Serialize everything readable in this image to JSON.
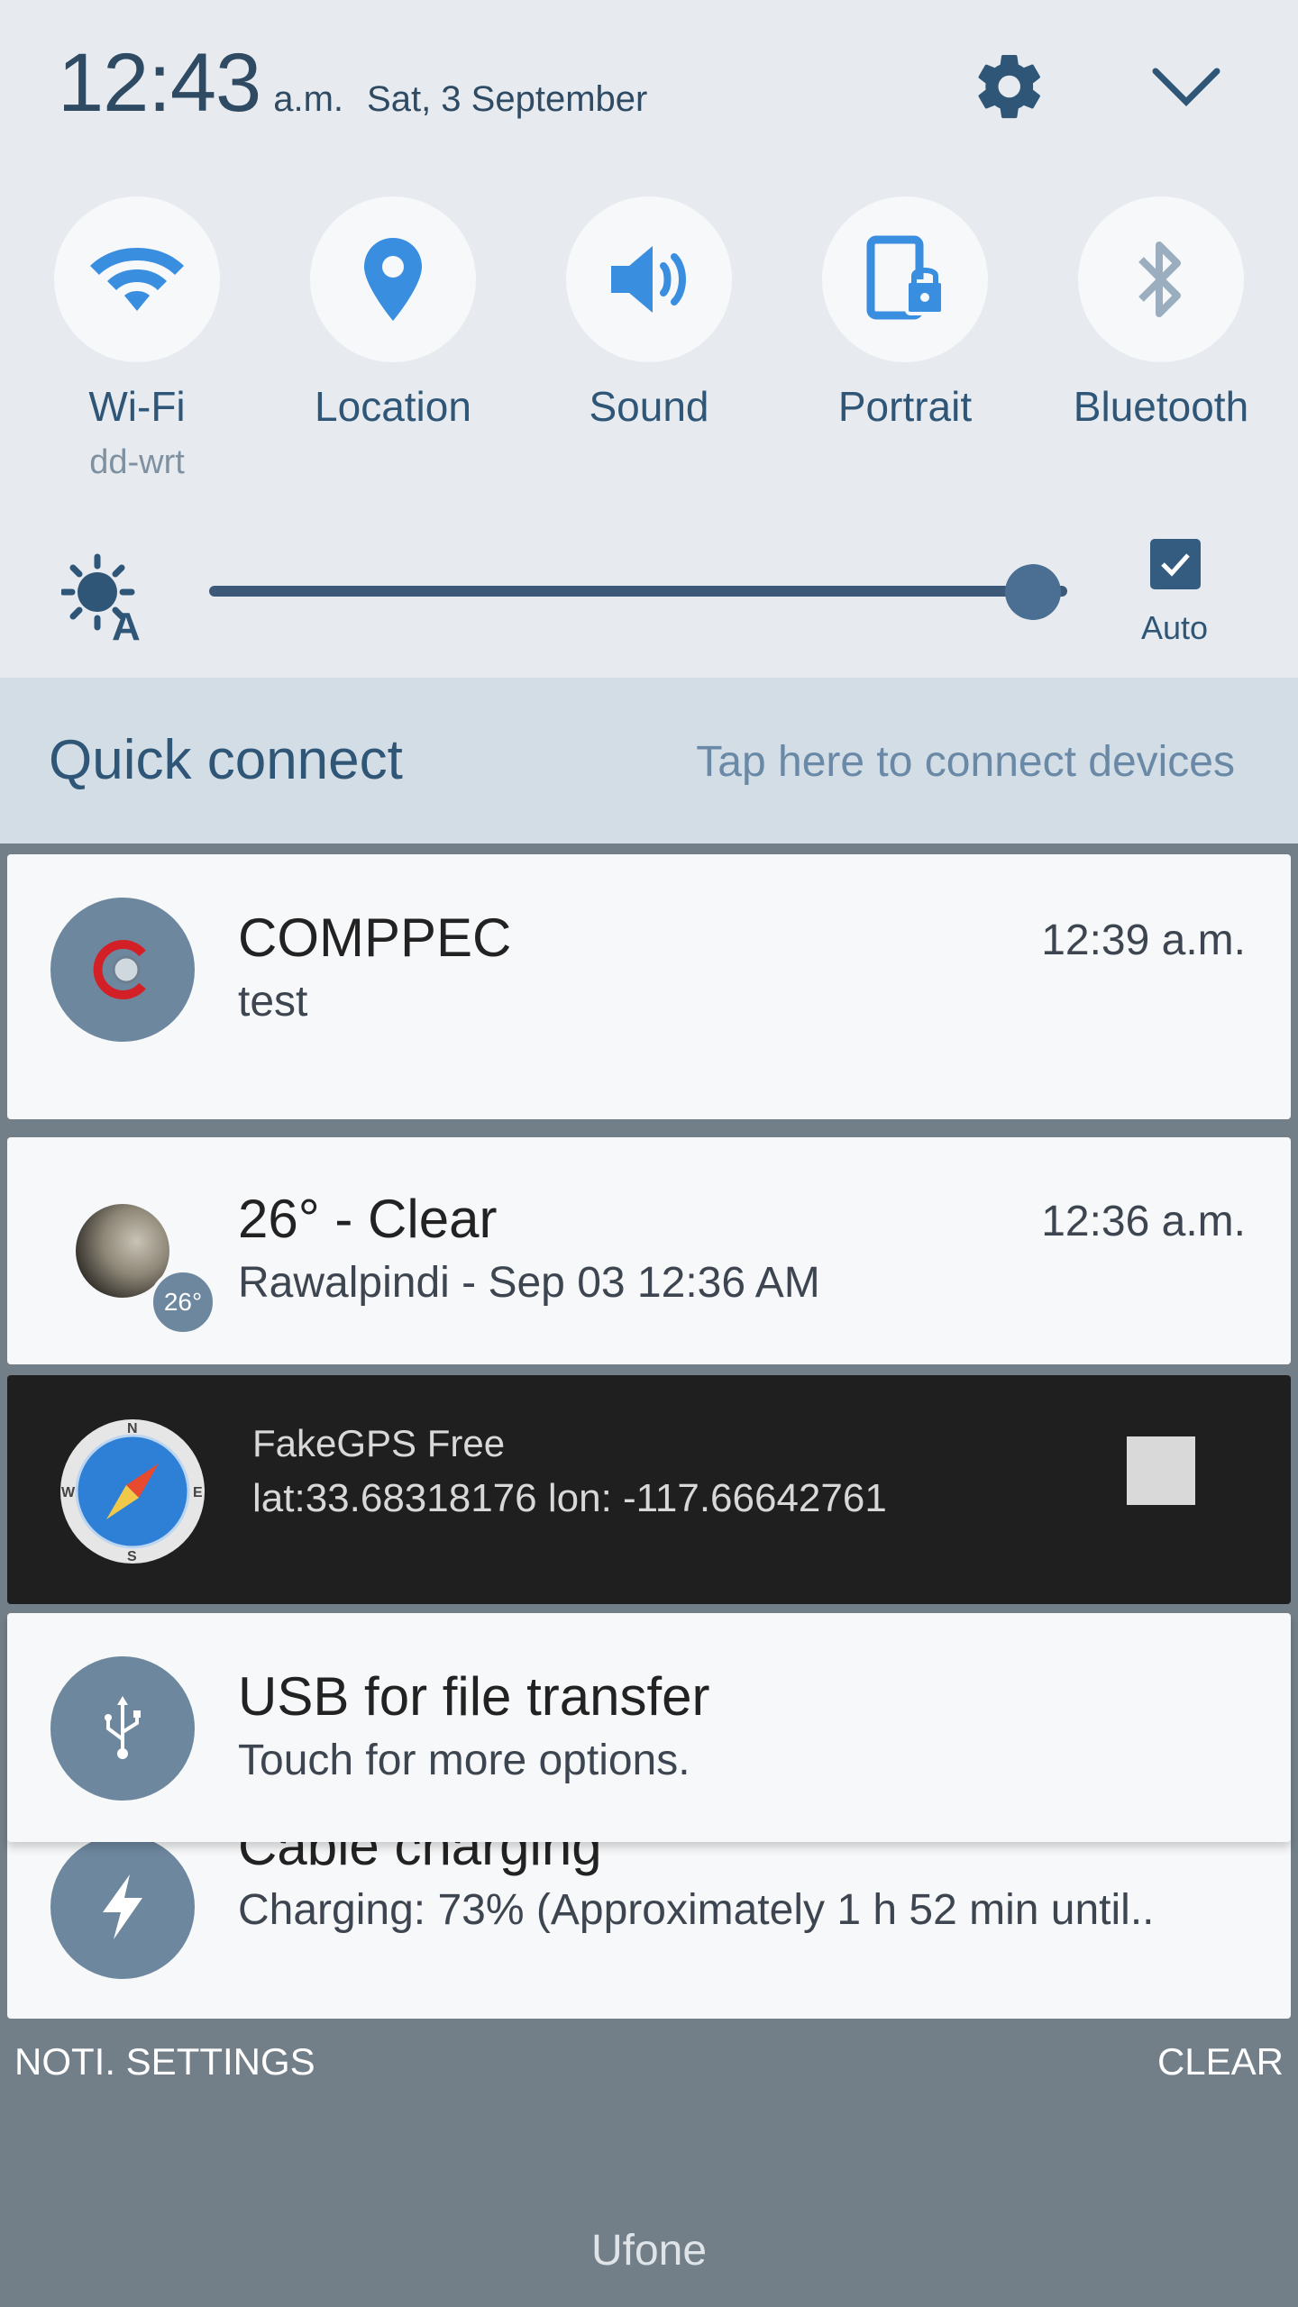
{
  "status": {
    "clock": "12:43",
    "ampm": "a.m.",
    "date": "Sat, 3 September"
  },
  "quick_settings": {
    "tiles": [
      {
        "label": "Wi-Fi",
        "sub": "dd-wrt",
        "icon": "wifi-icon"
      },
      {
        "label": "Location",
        "sub": "",
        "icon": "location-pin-icon"
      },
      {
        "label": "Sound",
        "sub": "",
        "icon": "speaker-icon"
      },
      {
        "label": "Portrait",
        "sub": "",
        "icon": "portrait-lock-icon"
      },
      {
        "label": "Bluetooth",
        "sub": "",
        "icon": "bluetooth-icon"
      }
    ],
    "brightness": {
      "level": 0.96,
      "auto_label": "Auto",
      "auto_checked": true
    }
  },
  "quick_connect": {
    "title": "Quick connect",
    "hint": "Tap here to connect devices"
  },
  "notifications": [
    {
      "title": "COMPPEC",
      "text": "test",
      "time": "12:39 a.m.",
      "icon": "comppec-app-icon"
    },
    {
      "title": "26° -  Clear",
      "text": "Rawalpindi - Sep 03  12:36 AM",
      "time": "12:36 a.m.",
      "icon": "moon-weather-icon",
      "badge": "26°"
    },
    {
      "title": "FakeGPS Free",
      "text": "lat:33.68318176 lon: -117.66642761",
      "icon": "compass-icon"
    },
    {
      "title": "USB for file transfer",
      "text": "Touch for more options.",
      "icon": "usb-icon"
    },
    {
      "title": "Cable charging",
      "text": "Charging: 73% (Approximately 1 h 52 min until..",
      "icon": "lightning-icon"
    }
  ],
  "actions": {
    "noti_settings": "NOTI. SETTINGS",
    "clear": "CLEAR"
  },
  "carrier": "Ufone",
  "colors": {
    "panel_bg": "#e7ebef",
    "accent": "#3a8ee0",
    "label": "#2f5677",
    "shade_bg": "#737f88"
  }
}
